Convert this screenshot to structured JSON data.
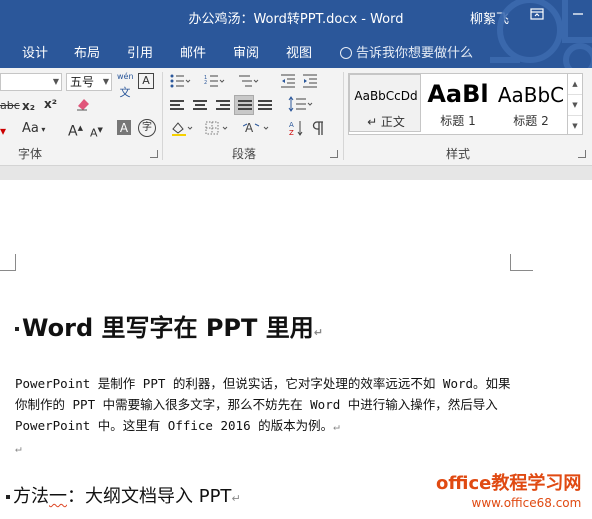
{
  "window": {
    "title": "办公鸡汤：Word转PPT.docx - Word",
    "user": "柳絮飞",
    "restore_icon": "ribbon-display-icon",
    "minimize_icon": "minimize-icon"
  },
  "ribbon_tabs": [
    "设计",
    "布局",
    "引用",
    "邮件",
    "审阅",
    "视图"
  ],
  "tell_me": "告诉我你想要做什么",
  "font_group": {
    "label": "字体",
    "font_name": "",
    "font_size": "五号",
    "phonetic_guide": "wén",
    "phonetic_char": "文",
    "enclose_char": "A",
    "strikethrough": "abc",
    "subscript": "x₂",
    "superscript": "x²",
    "text_effects": "Aa",
    "grow_font": "A",
    "shrink_font": "A",
    "char_shading": "A",
    "enclose_circle": "字"
  },
  "paragraph_group": {
    "label": "段落"
  },
  "styles_group": {
    "label": "样式",
    "items": [
      {
        "preview": "AaBbCcDd",
        "name": "↵ 正文"
      },
      {
        "preview": "AaBl",
        "name": "标题 1"
      },
      {
        "preview": "AaBbC",
        "name": "标题 2"
      }
    ]
  },
  "document": {
    "heading1": "Word 里写字在 PPT 里用",
    "paragraph": "PowerPoint 是制作 PPT 的利器，但说实话，它对字处理的效率远远不如 Word。如果你制作的 PPT 中需要输入很多文字，那么不妨先在 Word 中进行输入操作，然后导入 PowerPoint 中。这里有 Office 2016 的版本为例。",
    "paragraph_mark": "↵",
    "heading2_a": "方法",
    "heading2_b": "一",
    "heading2_c": "：大纲文档导入 PPT"
  },
  "watermark": {
    "line1": "office教程学习网",
    "line2": "www.office68.com"
  },
  "colors": {
    "accent": "#2b579a",
    "watermark": "#e04a12"
  }
}
